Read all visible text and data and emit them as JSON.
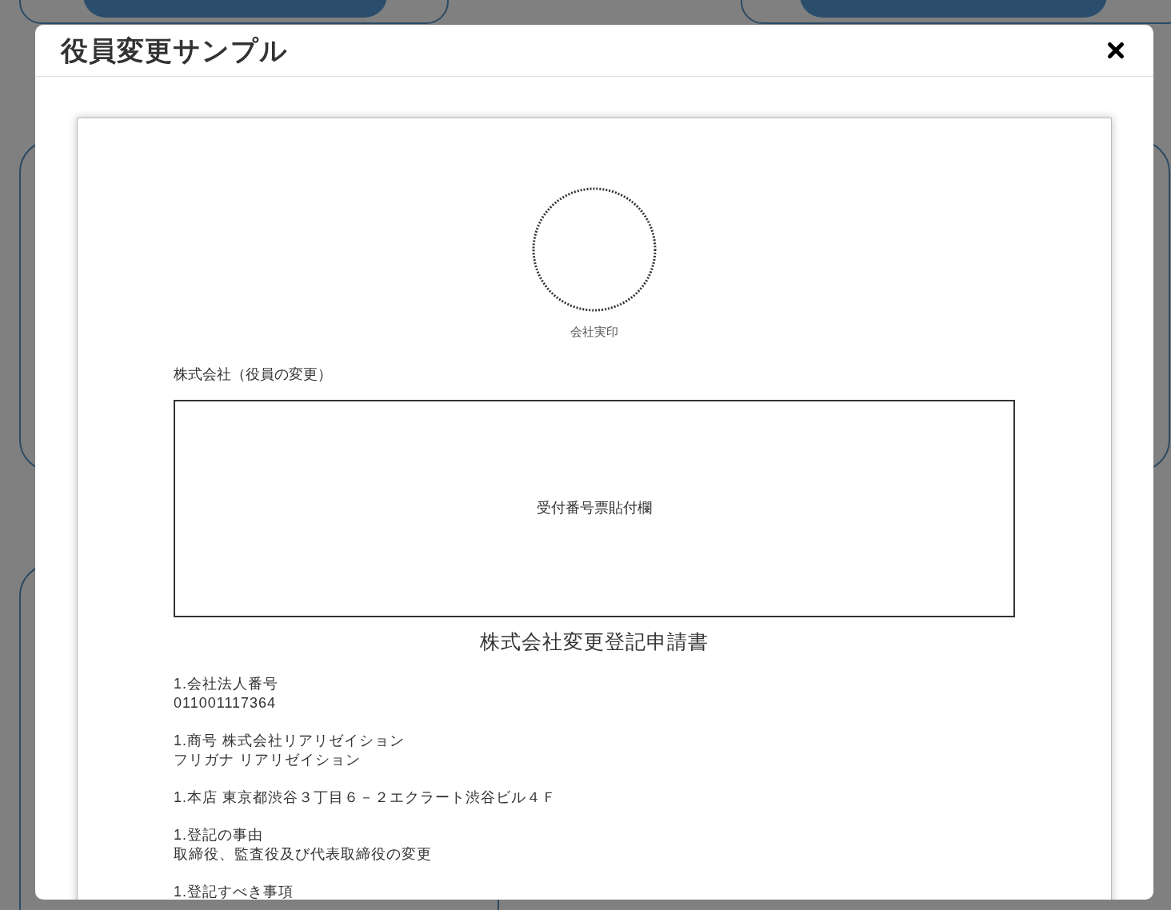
{
  "dialog": {
    "title": "役員変更サンプル"
  },
  "document": {
    "seal_label": "会社実印",
    "company_heading": "株式会社（役員の変更）",
    "stamp_area_label": "受付番号票貼付欄",
    "title": "株式会社変更登記申請書",
    "sections": [
      {
        "lines": [
          "1.会社法人番号",
          "011001117364"
        ]
      },
      {
        "lines": [
          "1.商号 株式会社リアリゼイション",
          "フリガナ リアリゼイション"
        ]
      },
      {
        "lines": [
          "1.本店 東京都渋谷３丁目６－２エクラート渋谷ビル４Ｆ"
        ]
      },
      {
        "lines": [
          "1.登記の事由",
          "取締役、監査役及び代表取締役の変更"
        ]
      },
      {
        "lines": [
          "1.登記すべき事項"
        ]
      }
    ]
  }
}
